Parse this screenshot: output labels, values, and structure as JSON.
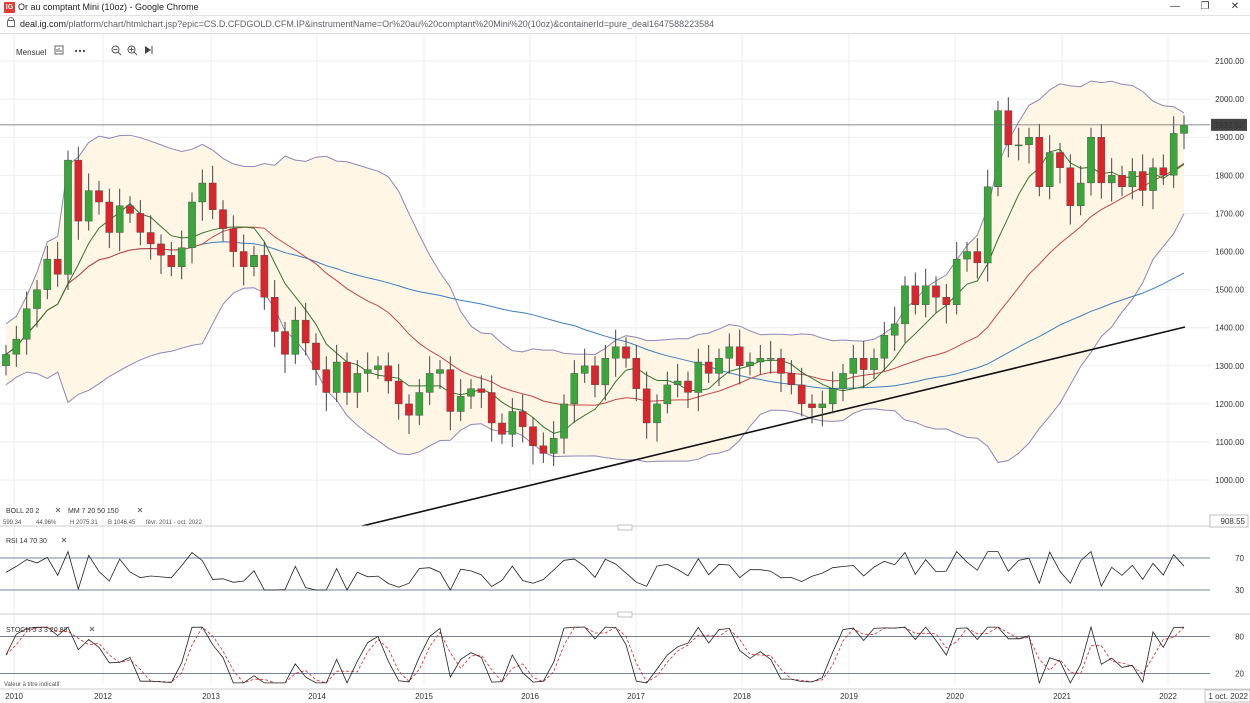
{
  "window": {
    "title": "Or au comptant Mini (10oz) - Google Chrome",
    "favicon": "IG",
    "controls": [
      "—",
      "❐",
      "✕"
    ]
  },
  "address_bar": {
    "host": "deal.ig.com",
    "path": "/platform/chart/htmlchart.jsp?epic=CS.D.CFDGOLD.CFM.IP&instrumentName=Or%20au%20comptant%20Mini%20(10oz)&containerId=pure_deal1647588223584"
  },
  "toolbar": {
    "period": "Mensuel",
    "buttons": [
      "chart-type-icon",
      "more-icon",
      "zoom-out-icon",
      "zoom-in-icon",
      "play-icon"
    ]
  },
  "chart_data": {
    "type": "candlestick",
    "price_axis": {
      "ticks": [
        "2100.00",
        "2000.00",
        "1900.00",
        "1800.00",
        "1700.00",
        "1600.00",
        "1500.00",
        "1400.00",
        "1300.00",
        "1200.00",
        "1100.00",
        "1000.00"
      ],
      "ylim": [
        908.55,
        2150
      ],
      "current_price": "1932.52",
      "low_label": "908.55"
    },
    "x_axis": {
      "ticks": [
        "2010",
        "2012",
        "2013",
        "2014",
        "2015",
        "2016",
        "2017",
        "2018",
        "2019",
        "2020",
        "2021",
        "2022"
      ],
      "cursor_label": "1 oct. 2022"
    },
    "overlays_legend": {
      "boll": "BOLL  20  2",
      "mm": "MM  7  20  50  150",
      "value_left": "599.34",
      "pct": "44.96%",
      "high": "H 2075.31",
      "low": "B 1046.45",
      "range": "févr. 2011 - oct. 2022"
    },
    "closes": [
      1330,
      1370,
      1450,
      1500,
      1580,
      1540,
      1840,
      1680,
      1760,
      1730,
      1650,
      1720,
      1700,
      1650,
      1620,
      1590,
      1560,
      1610,
      1730,
      1780,
      1710,
      1660,
      1600,
      1560,
      1590,
      1480,
      1390,
      1330,
      1420,
      1360,
      1290,
      1230,
      1310,
      1230,
      1280,
      1290,
      1300,
      1260,
      1200,
      1170,
      1230,
      1280,
      1290,
      1180,
      1220,
      1240,
      1230,
      1150,
      1120,
      1180,
      1140,
      1090,
      1070,
      1110,
      1200,
      1280,
      1300,
      1250,
      1320,
      1350,
      1320,
      1240,
      1150,
      1200,
      1250,
      1260,
      1230,
      1310,
      1280,
      1320,
      1350,
      1300,
      1310,
      1320,
      1320,
      1280,
      1250,
      1200,
      1190,
      1200,
      1240,
      1280,
      1320,
      1290,
      1320,
      1380,
      1410,
      1510,
      1460,
      1510,
      1480,
      1460,
      1580,
      1600,
      1570,
      1770,
      1970,
      1880,
      1880,
      1900,
      1770,
      1860,
      1820,
      1720,
      1780,
      1900,
      1780,
      1800,
      1770,
      1810,
      1760,
      1820,
      1800,
      1910,
      1932.52
    ],
    "rsi": {
      "label": "RSI  14  70  30",
      "levels": [
        "70",
        "30"
      ]
    },
    "stoch": {
      "label": "STOCH  5  3  3  20  80",
      "levels": [
        "80",
        "20"
      ],
      "note": "Valeur à titre indicatif"
    }
  }
}
